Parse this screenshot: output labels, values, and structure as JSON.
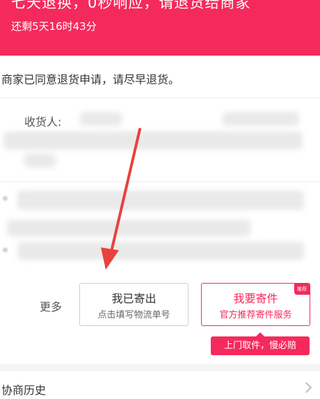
{
  "header": {
    "title": "七天退换，0秒响应，请退货给商家",
    "countdown": "还剩5天16时43分"
  },
  "notice": {
    "text": "商家已同意退货申请，请尽早退货。"
  },
  "address": {
    "receiver_label": "收货人:"
  },
  "more": {
    "label": "更多",
    "shipped_button": {
      "title": "我已寄出",
      "subtitle": "点击填写物流单号"
    },
    "pickup_button": {
      "title": "我要寄件",
      "subtitle": "官方推荐寄件服务",
      "badge": "推荐"
    },
    "tooltip": "上门取件，慢必赔"
  },
  "history": {
    "label": "协商历史"
  },
  "colors": {
    "accent": "#f42a5c"
  },
  "icons": {
    "history_chevron": "chevron-right-icon",
    "annotation_arrow": "red-arrow-icon"
  }
}
